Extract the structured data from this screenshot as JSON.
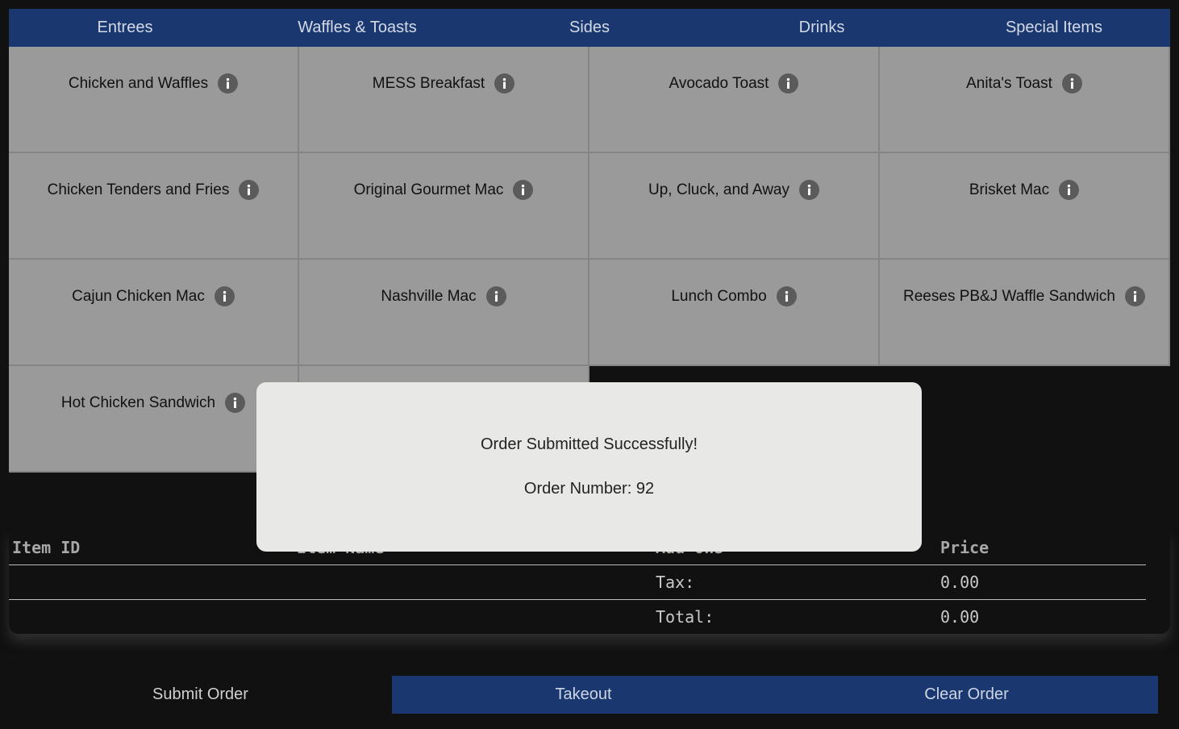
{
  "tabs": [
    "Entrees",
    "Waffles & Toasts",
    "Sides",
    "Drinks",
    "Special Items"
  ],
  "menu_items": [
    "Chicken and Waffles",
    "MESS Breakfast",
    "Avocado Toast",
    "Anita's Toast",
    "Chicken Tenders and Fries",
    "Original Gourmet Mac",
    "Up, Cluck, and Away",
    "Brisket Mac",
    "Cajun Chicken Mac",
    "Nashville Mac",
    "Lunch Combo",
    "Reeses PB&J Waffle Sandwich",
    "Hot Chicken Sandwich",
    ""
  ],
  "order_table": {
    "headers": {
      "item_id": "Item ID",
      "item_name": "Item Name",
      "add_ons": "Add-Ons",
      "price": "Price"
    },
    "tax_label": "Tax:",
    "tax_value": "0.00",
    "total_label": "Total:",
    "total_value": "0.00"
  },
  "modal": {
    "title": "Order Submitted Successfully!",
    "order_number": "Order Number: 92"
  },
  "buttons": {
    "submit": "Submit Order",
    "takeout": "Takeout",
    "clear": "Clear Order"
  },
  "colors": {
    "accent": "#1a386f",
    "background": "#111111",
    "menu_cell": "#9a9a9a",
    "modal": "#e8e8e6"
  },
  "icons": {
    "menu_item_info": "info-icon"
  }
}
